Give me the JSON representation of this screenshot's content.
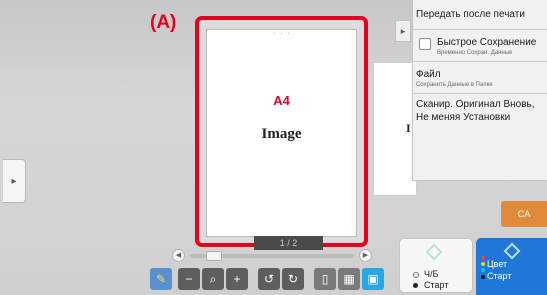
{
  "annotation_label": "(A)",
  "preview": {
    "paper_size": "A4",
    "image_label": "Image",
    "page_counter": "1 / 2",
    "next_page_fragment": "I",
    "top_dots": "· · ·"
  },
  "left_panel_toggle": "▸",
  "right_panel_toggle": "▸",
  "actions": {
    "send_after_print": "Передать после печати",
    "quick_save": "Быстрое Сохранение",
    "quick_save_sub": "Временно Сохран. Данные",
    "file": "Файл",
    "file_sub": "Сохранить Данные в Папке",
    "rescan": "Сканир. Оригинал Вновь, Не меняя Установки"
  },
  "ca_button": "CA",
  "bw_start": {
    "line1": "Ч/Б",
    "line2": "Старт"
  },
  "color_start": {
    "line1": "Цвет",
    "line2": "Старт"
  },
  "toolbar": {
    "edit_icon": "✎",
    "zoom_out": "−",
    "zoom": "⌕",
    "zoom_in": "+",
    "rotate_left": "↺",
    "rotate_right": "↻",
    "single_view": "▯",
    "grid_view": "▦",
    "multi_view": "▣"
  },
  "colors": {
    "highlight": "#e8001e",
    "ca": "#e08a3a",
    "color_start": "#1f78d8",
    "toolbar_active": "#2aa6e3"
  }
}
